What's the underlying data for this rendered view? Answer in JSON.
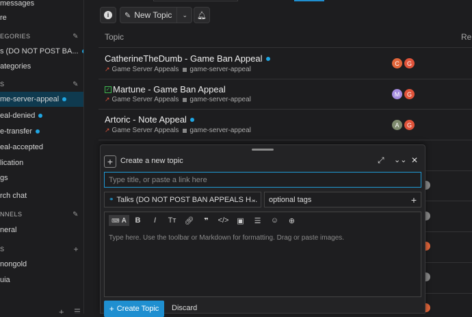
{
  "sidebar": {
    "messages": "messages",
    "more": "re",
    "categories_head": "EGORIES",
    "cat_item1": "s (DO NOT POST BA...",
    "all_categories": "ategories",
    "tags_head": "s",
    "tag_active": "me-server-appeal",
    "tag2": "eal-denied",
    "tag3": "e-transfer",
    "tag4": "eal-accepted",
    "tag5": "lication",
    "all_tags": "gs",
    "chat_search": "rch chat",
    "channels_head": "NNELS",
    "channel1": "neral",
    "dm_head": "s",
    "dm1": "nongold",
    "dm2": "uia",
    "footer_plus": "+"
  },
  "toolbar": {
    "info_icon": "info-icon",
    "new_topic_label": "New Topic",
    "bell_icon": "bell-icon"
  },
  "list": {
    "col_topic": "Topic",
    "col_replies": "Rep",
    "topics": [
      {
        "title": "CatherineTheDumb - Game Ban Appeal",
        "unread": true,
        "category": "Game Server Appeals",
        "tag": "game-server-appeal",
        "avatars": [
          "C",
          "G"
        ]
      },
      {
        "title": "Martune - Game Ban Appeal",
        "solved": true,
        "category": "Game Server Appeals",
        "tag": "game-server-appeal",
        "avatars": [
          "M",
          "G"
        ]
      },
      {
        "title": "Artoric - Note Appeal",
        "unread": true,
        "category": "Game Server Appeals",
        "tag": "game-server-appeal",
        "avatars": [
          "A",
          "G"
        ]
      }
    ]
  },
  "composer": {
    "heading": "Create a new topic",
    "title_placeholder": "Type title, or paste a link here",
    "category": "Talks (DO NOT POST BAN APPEALS H...",
    "tags_placeholder": "optional tags",
    "editor_placeholder": "Type here. Use the toolbar or Markdown for formatting. Drag or paste images.",
    "create_label": "Create Topic",
    "discard_label": "Discard"
  },
  "colors": {
    "accent": "#1f8fd0",
    "unread_dot": "#1fa6e3",
    "avatar_c": "#e0653a",
    "avatar_m": "#a58ce0",
    "avatar_a": "#7e8a6e"
  }
}
